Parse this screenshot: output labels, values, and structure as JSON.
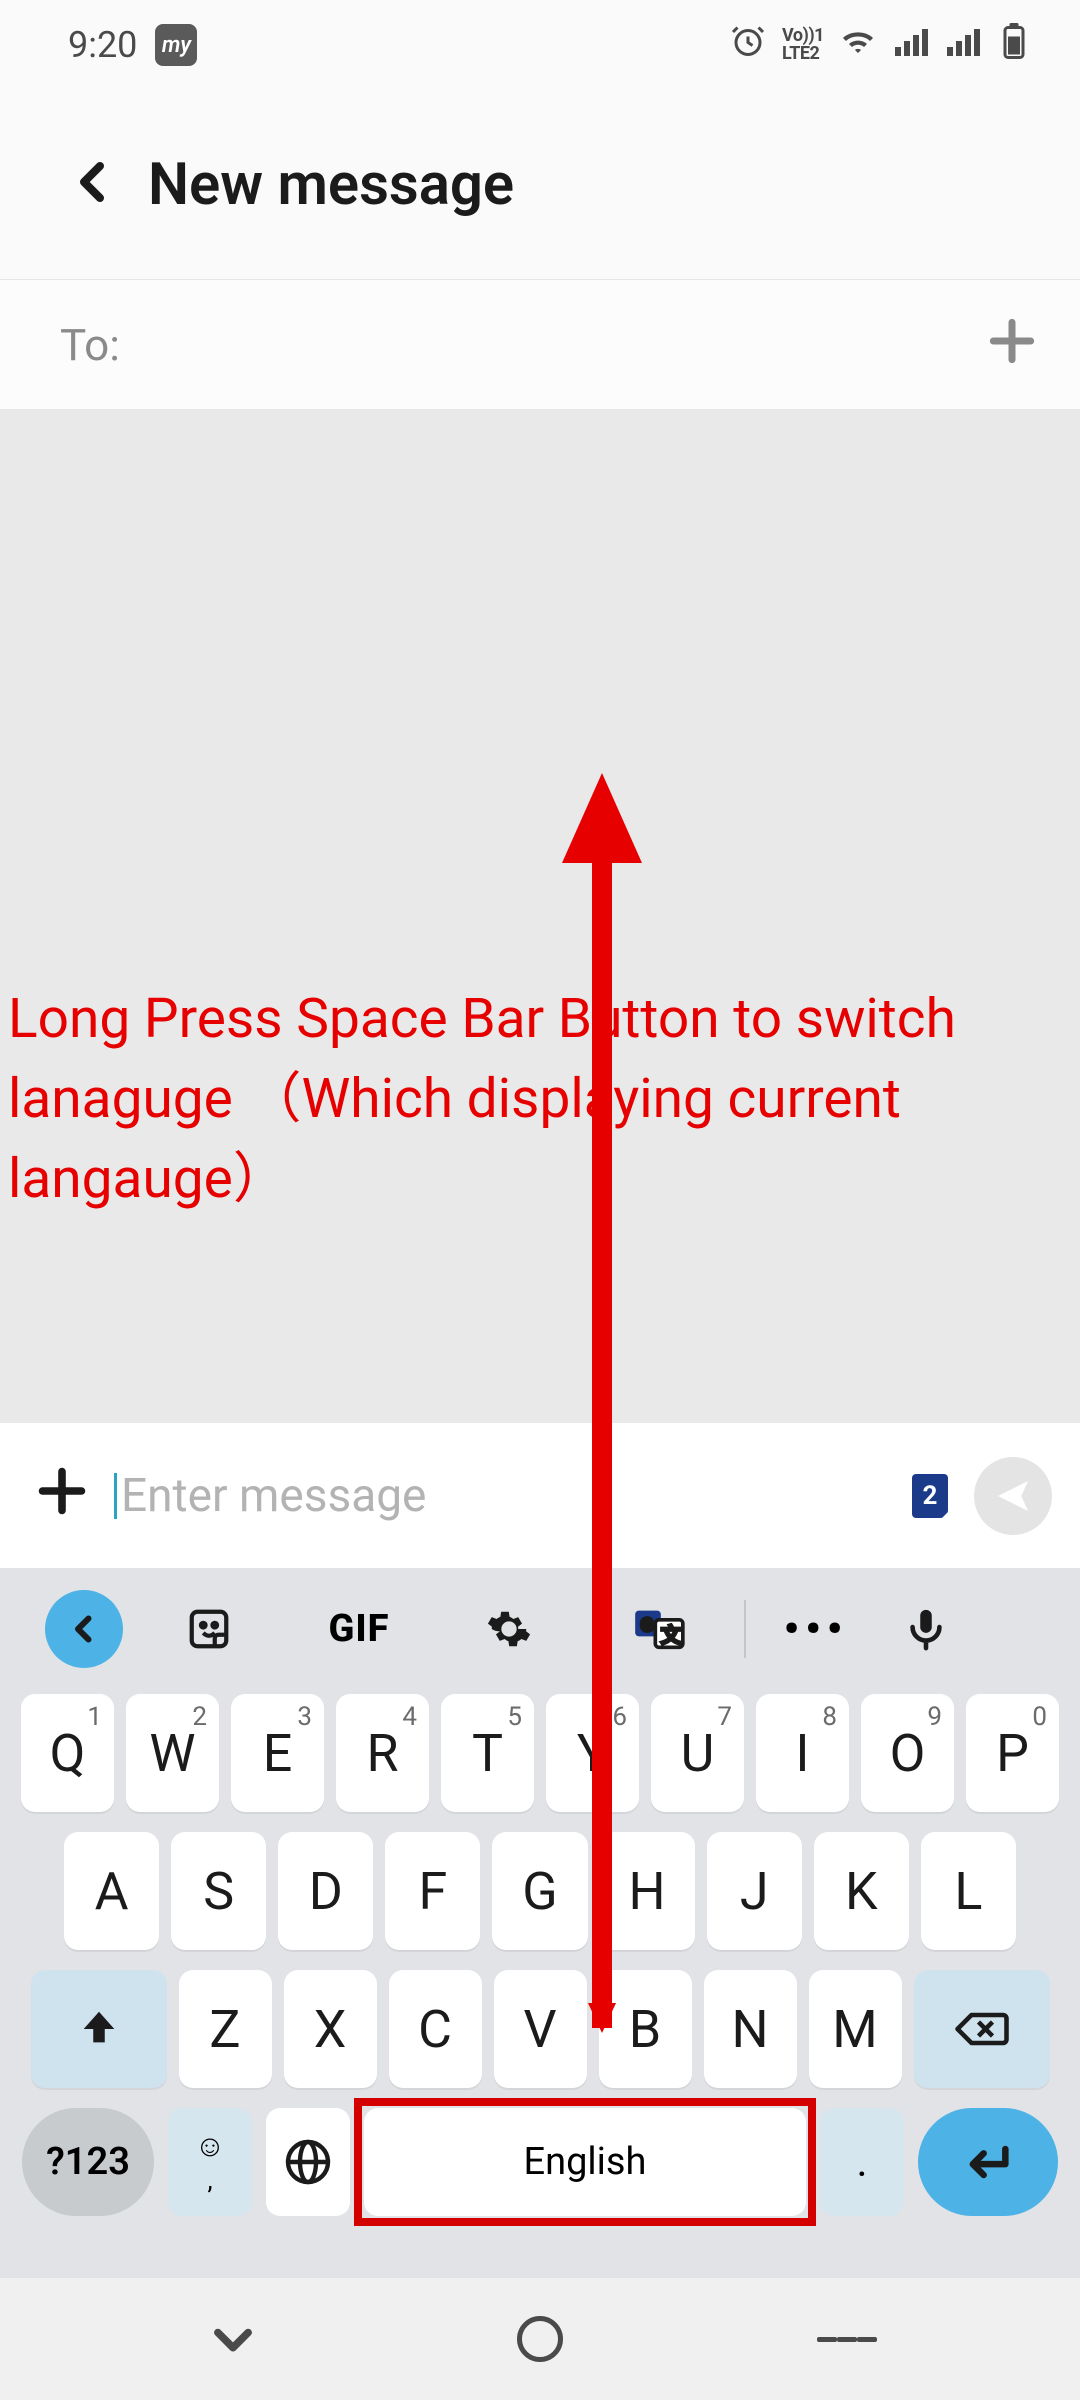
{
  "status": {
    "time": "9:20",
    "app_badge": "my",
    "volte": "Vo))1\nLTE2"
  },
  "header": {
    "title": "New message"
  },
  "recipient": {
    "label": "To:"
  },
  "annotation": {
    "text": "Long Press Space Bar Button to switch lanaguge （Which displaying current langauge）"
  },
  "compose": {
    "placeholder": "Enter message",
    "sim_badge": "2"
  },
  "keyboard": {
    "toolbar": {
      "gif": "GIF"
    },
    "row1": [
      {
        "k": "Q",
        "s": "1"
      },
      {
        "k": "W",
        "s": "2"
      },
      {
        "k": "E",
        "s": "3"
      },
      {
        "k": "R",
        "s": "4"
      },
      {
        "k": "T",
        "s": "5"
      },
      {
        "k": "Y",
        "s": "6"
      },
      {
        "k": "U",
        "s": "7"
      },
      {
        "k": "I",
        "s": "8"
      },
      {
        "k": "O",
        "s": "9"
      },
      {
        "k": "P",
        "s": "0"
      }
    ],
    "row2": [
      "A",
      "S",
      "D",
      "F",
      "G",
      "H",
      "J",
      "K",
      "L"
    ],
    "row3": [
      "Z",
      "X",
      "C",
      "V",
      "B",
      "N",
      "M"
    ],
    "numkey": "?123",
    "space_label": "English",
    "dot": "."
  }
}
